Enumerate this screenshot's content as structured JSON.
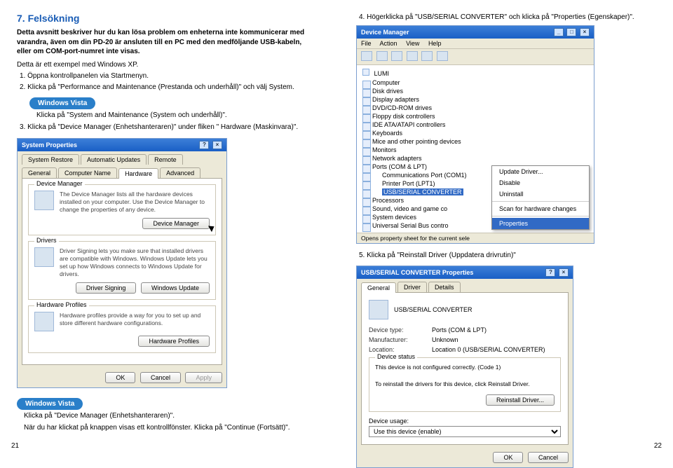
{
  "left": {
    "section_title": "7. Felsökning",
    "intro": "Detta avsnitt beskriver hur du kan lösa problem om enheterna inte kommunicerar med varandra, även om din PD-20 är ansluten till en PC med den medföljande USB-kabeln, eller om COM-port-numret inte visas.",
    "note": "Detta är ett exempel med Windows XP.",
    "step1": "1. Öppna kontrollpanelen via Startmenyn.",
    "step2": "2. Klicka på \"Performance and Maintenance (Prestanda och underhåll)\" och välj System.",
    "vista_label": "Windows Vista",
    "vista_step2": "Klicka på \"System and Maintenance (System och underhåll)\".",
    "step3": "3. Klicka på \"Device Manager (Enhetshanteraren)\" under fliken \" Hardware (Maskinvara)\".",
    "page_num": "21"
  },
  "right": {
    "step4": "4. Högerklicka på \"USB/SERIAL CONVERTER\" och klicka på \"Properties (Egenskaper)\".",
    "step5": "5. Klicka på \"Reinstall Driver (Uppdatera drivrutin)\"",
    "vista_label": "Windows Vista",
    "vista_text1": "Klicka på \"Device Manager (Enhetshanteraren)\".",
    "vista_text2": "När du har klickat på knappen visas ett kontrollfönster. Klicka på \"Continue (Fortsätt)\".",
    "page_num": "22"
  },
  "sysprops": {
    "title": "System Properties",
    "tabs_row1": [
      "System Restore",
      "Automatic Updates",
      "Remote"
    ],
    "tabs_row2": [
      "General",
      "Computer Name",
      "Hardware",
      "Advanced"
    ],
    "grp_dm_title": "Device Manager",
    "grp_dm_text": "The Device Manager lists all the hardware devices installed on your computer. Use the Device Manager to change the properties of any device.",
    "btn_dm": "Device Manager",
    "grp_drv_title": "Drivers",
    "grp_drv_text": "Driver Signing lets you make sure that installed drivers are compatible with Windows. Windows Update lets you set up how Windows connects to Windows Update for drivers.",
    "btn_sign": "Driver Signing",
    "btn_wu": "Windows Update",
    "grp_hw_title": "Hardware Profiles",
    "grp_hw_text": "Hardware profiles provide a way for you to set up and store different hardware configurations.",
    "btn_hw": "Hardware Profiles",
    "ok": "OK",
    "cancel": "Cancel",
    "apply": "Apply"
  },
  "devmgr": {
    "title": "Device Manager",
    "menu": [
      "File",
      "Action",
      "View",
      "Help"
    ],
    "root": "LUMI",
    "items": [
      "Computer",
      "Disk drives",
      "Display adapters",
      "DVD/CD-ROM drives",
      "Floppy disk controllers",
      "IDE ATA/ATAPI controllers",
      "Keyboards",
      "Mice and other pointing devices",
      "Monitors",
      "Network adapters",
      "Ports (COM & LPT)"
    ],
    "port_children": [
      "Communications Port (COM1)",
      "Printer Port (LPT1)"
    ],
    "selected": "USB/SERIAL CONVERTER",
    "items_after": [
      "Processors",
      "Sound, video and game co",
      "System devices",
      "Universal Serial Bus contro"
    ],
    "ctx": {
      "update": "Update Driver...",
      "disable": "Disable",
      "uninstall": "Uninstall",
      "scan": "Scan for hardware changes",
      "props": "Properties"
    },
    "status": "Opens property sheet for the current sele"
  },
  "props": {
    "title": "USB/SERIAL CONVERTER Properties",
    "tabs": [
      "General",
      "Driver",
      "Details"
    ],
    "devname": "USB/SERIAL CONVERTER",
    "type_lab": "Device type:",
    "type_val": "Ports (COM & LPT)",
    "mfr_lab": "Manufacturer:",
    "mfr_val": "Unknown",
    "loc_lab": "Location:",
    "loc_val": "Location 0 (USB/SERIAL CONVERTER)",
    "status_title": "Device status",
    "status_text1": "This device is not configured correctly. (Code 1)",
    "status_text2": "To reinstall the drivers for this device, click Reinstall Driver.",
    "btn_reinstall": "Reinstall Driver...",
    "usage_lab": "Device usage:",
    "usage_val": "Use this device (enable)",
    "ok": "OK",
    "cancel": "Cancel"
  }
}
